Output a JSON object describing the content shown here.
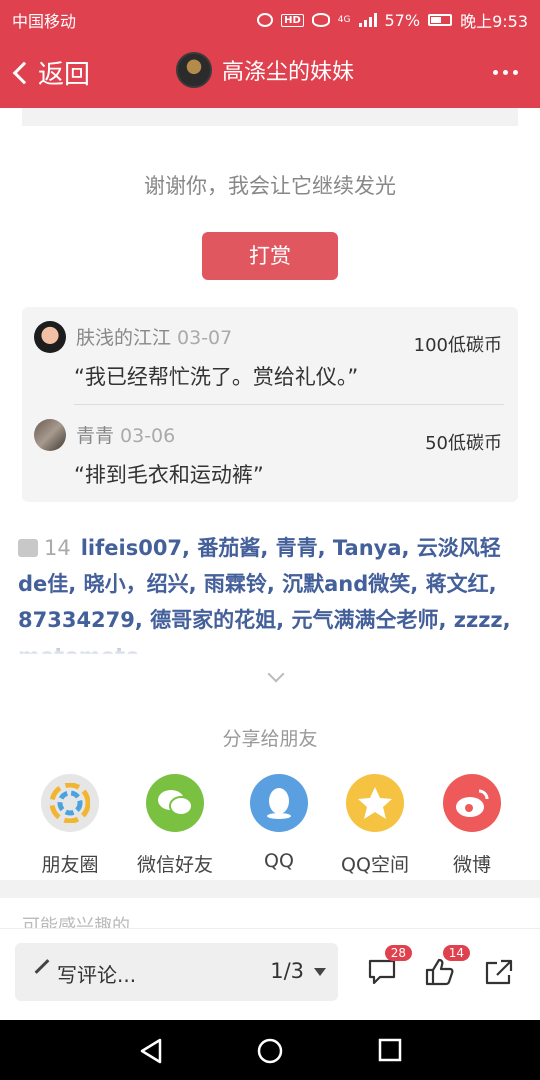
{
  "status_bar": {
    "carrier": "中国移动",
    "battery": "57%",
    "time": "晚上9:53",
    "network": "4G"
  },
  "header": {
    "back_label": "返回",
    "title": "高涤尘的妹妹"
  },
  "thanks_text": "谢谢你，我会让它继续发光",
  "reward_button": "打赏",
  "rewards": [
    {
      "name": "肤浅的江江",
      "date": "03-07",
      "amount": "100低碳币",
      "message": "“我已经帮忙洗了。赏给礼仪。”"
    },
    {
      "name": "青青",
      "date": "03-06",
      "amount": "50低碳币",
      "message": "“排到毛衣和运动裤”"
    }
  ],
  "likes": {
    "count": "14",
    "names": "lifeis007, 番茄酱, 青青, Tanya, 云淡风轻de佳, 晓小，绍兴, 雨霖铃, 沉默and微笑, 蒋文红, 87334279, 德哥家的花姐, 元气满满仝老师, zzzz, motomoto"
  },
  "share": {
    "label": "分享给朋友",
    "items": [
      {
        "label": "朋友圈",
        "color": "#e6e6e6"
      },
      {
        "label": "微信好友",
        "color": "#7ac142"
      },
      {
        "label": "QQ",
        "color": "#5aa0e0"
      },
      {
        "label": "QQ空间",
        "color": "#f5c242"
      },
      {
        "label": "微博",
        "color": "#ee5a5a"
      }
    ]
  },
  "peek_text": "可能感兴趣的",
  "bottom_bar": {
    "comment_placeholder": "写评论...",
    "page": "1/3",
    "comment_count": "28",
    "like_count": "14"
  },
  "colors": {
    "brand": "#e0414f",
    "link": "#44609b"
  }
}
